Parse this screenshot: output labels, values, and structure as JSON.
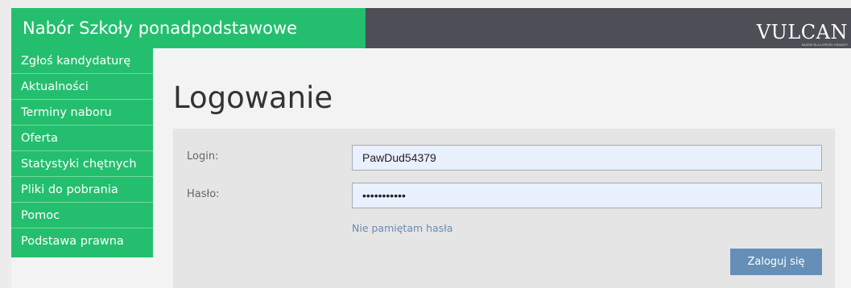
{
  "header": {
    "title": "Nabór Szkoły ponadpodstawowe",
    "logo_text": "VULCAN",
    "logo_tagline": "RAZEM DLA LEPSZEJ OŚWIATY"
  },
  "sidebar": {
    "items": [
      {
        "label": "Zgłoś kandydaturę"
      },
      {
        "label": "Aktualności"
      },
      {
        "label": "Terminy naboru"
      },
      {
        "label": "Oferta"
      },
      {
        "label": "Statystyki chętnych"
      },
      {
        "label": "Pliki do pobrania"
      },
      {
        "label": "Pomoc"
      },
      {
        "label": "Podstawa prawna"
      }
    ]
  },
  "main": {
    "title": "Logowanie",
    "login_label": "Login:",
    "login_value": "PawDud54379",
    "password_label": "Hasło:",
    "password_value": "passwordxyz",
    "forgot_link": "Nie pamiętam hasła",
    "submit_label": "Zaloguj się"
  },
  "colors": {
    "accent_green": "#24bf6e",
    "header_dark": "#4e4e57",
    "button_blue": "#658fb6",
    "panel_gray": "#e5e5e5"
  }
}
